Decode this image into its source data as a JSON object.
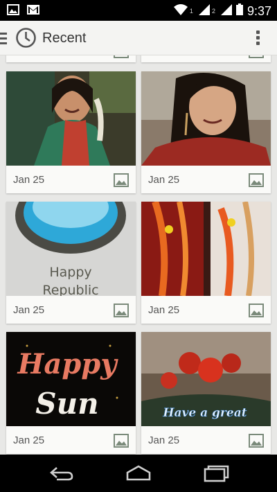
{
  "status_bar": {
    "time": "9:37",
    "sim1": "1",
    "sim2": "2",
    "icons": [
      "image-notification-icon",
      "gmail-icon",
      "wifi-icon",
      "signal-icon",
      "battery-icon"
    ]
  },
  "app_bar": {
    "title": "Recent",
    "icons": [
      "menu-icon",
      "clock-icon",
      "overflow-menu-icon"
    ]
  },
  "cards": [
    {
      "date": "Jan 25",
      "image": "woman-green-saree",
      "type_icon": "image-icon"
    },
    {
      "date": "Jan 25",
      "image": "woman-red-dress",
      "type_icon": "image-icon"
    },
    {
      "date": "Jan 25",
      "image": "Happy Republic",
      "type_icon": "image-icon"
    },
    {
      "date": "Jan 25",
      "image": "wedding-garlands",
      "type_icon": "image-icon"
    },
    {
      "date": "Jan 25",
      "image": "Happy Sun",
      "type_icon": "image-icon"
    },
    {
      "date": "Jan 25",
      "image": "Have a great",
      "type_icon": "image-icon"
    }
  ],
  "texts": {
    "happy": "Happy",
    "republic": "Republic",
    "happy2": "Happy",
    "sun": "Sun",
    "have_a_great": "Have a great"
  },
  "colors": {
    "status_bar": "#000000",
    "app_bar": "#f4f4f2",
    "background": "#e8e8e6",
    "card": "#fafaf8"
  }
}
